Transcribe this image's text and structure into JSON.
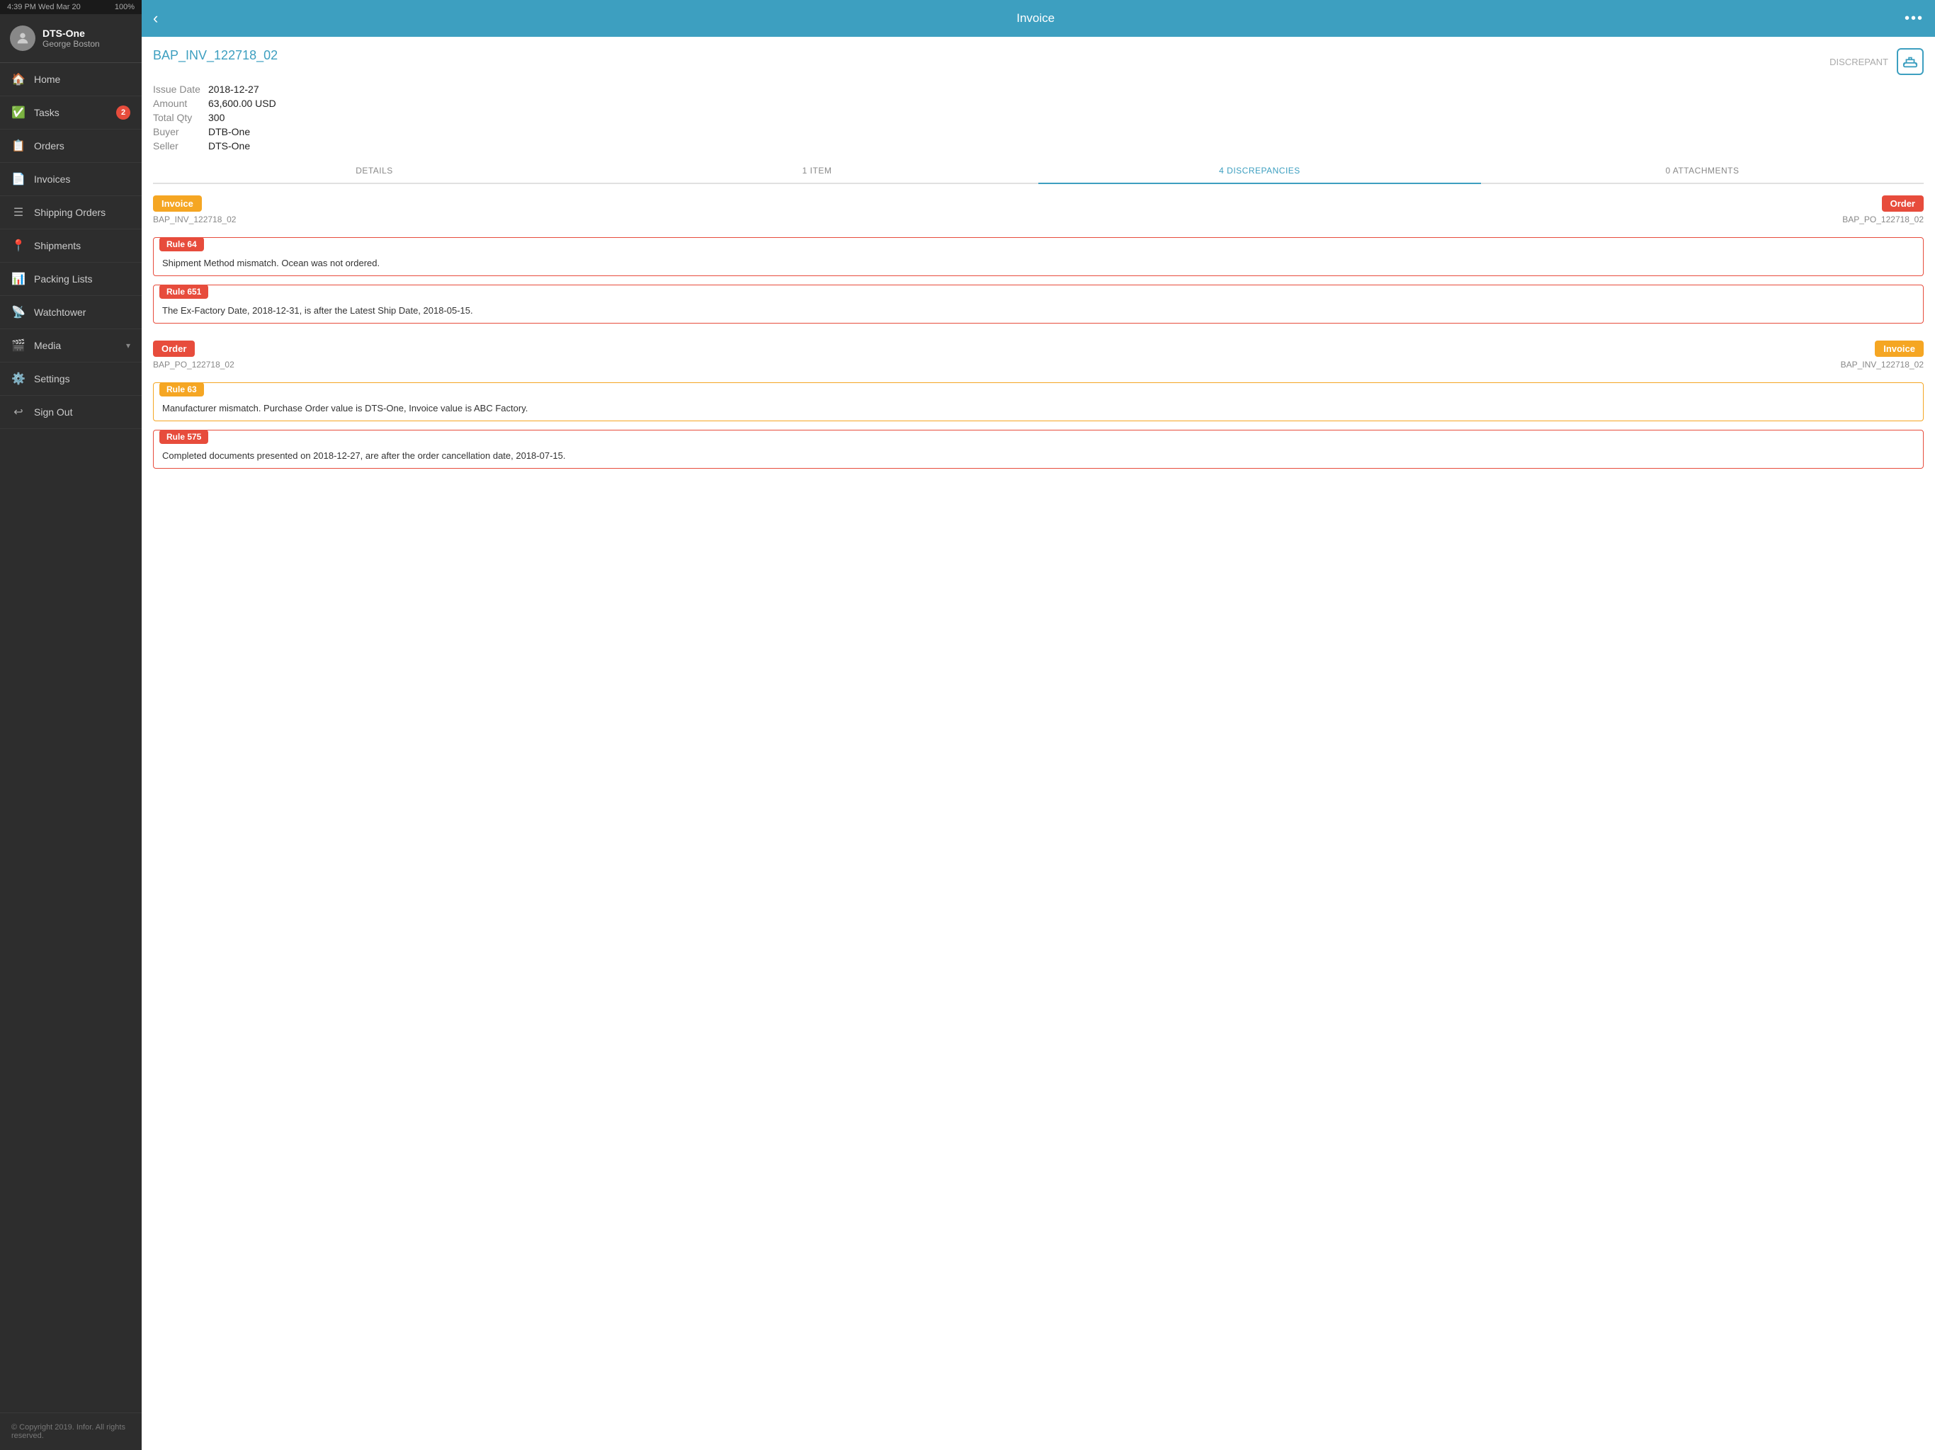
{
  "statusBar": {
    "time": "4:39 PM Wed Mar 20",
    "battery": "100%"
  },
  "sidebar": {
    "userName": "DTS-One",
    "userSub": "George Boston",
    "items": [
      {
        "id": "home",
        "label": "Home",
        "icon": "🏠",
        "badge": null
      },
      {
        "id": "tasks",
        "label": "Tasks",
        "icon": "✅",
        "badge": "2"
      },
      {
        "id": "orders",
        "label": "Orders",
        "icon": "📋",
        "badge": null
      },
      {
        "id": "invoices",
        "label": "Invoices",
        "icon": "📄",
        "badge": null
      },
      {
        "id": "shipping-orders",
        "label": "Shipping Orders",
        "icon": "☰",
        "badge": null
      },
      {
        "id": "shipments",
        "label": "Shipments",
        "icon": "📍",
        "badge": null
      },
      {
        "id": "packing-lists",
        "label": "Packing Lists",
        "icon": "📊",
        "badge": null
      },
      {
        "id": "watchtower",
        "label": "Watchtower",
        "icon": "📡",
        "badge": null
      },
      {
        "id": "media",
        "label": "Media",
        "icon": "🎬",
        "badge": null,
        "arrow": "▾"
      },
      {
        "id": "settings",
        "label": "Settings",
        "icon": "⚙️",
        "badge": null
      },
      {
        "id": "sign-out",
        "label": "Sign Out",
        "icon": "↩",
        "badge": null
      }
    ],
    "copyright": "© Copyright 2019. Infor. All rights reserved."
  },
  "header": {
    "title": "Invoice",
    "backLabel": "‹",
    "moreLabel": "•••"
  },
  "invoice": {
    "id": "BAP_INV_122718_02",
    "discrepant": "DISCREPANT",
    "issueDate": "2018-12-27",
    "amount": "63,600.00 USD",
    "totalQty": "300",
    "buyer": "DTB-One",
    "seller": "DTS-One",
    "issueDateLabel": "Issue Date",
    "amountLabel": "Amount",
    "totalQtyLabel": "Total Qty",
    "buyerLabel": "Buyer",
    "sellerLabel": "Seller"
  },
  "tabs": [
    {
      "id": "details",
      "label": "DETAILS",
      "active": false
    },
    {
      "id": "items",
      "label": "1 ITEM",
      "active": false
    },
    {
      "id": "discrepancies",
      "label": "4 DISCREPANCIES",
      "active": true
    },
    {
      "id": "attachments",
      "label": "0 ATTACHMENTS",
      "active": false
    }
  ],
  "discrepancies": [
    {
      "leftTag": "Invoice",
      "leftTagClass": "tag-invoice",
      "leftId": "BAP_INV_122718_02",
      "rightTag": "Order",
      "rightTagClass": "tag-order",
      "rightId": "BAP_PO_122718_02",
      "rules": [
        {
          "ruleLabel": "Rule 64",
          "ruleClass": "red",
          "text": "Shipment Method mismatch. Ocean was not ordered."
        },
        {
          "ruleLabel": "Rule 651",
          "ruleClass": "red",
          "text": "The Ex-Factory Date, 2018-12-31, is after the Latest Ship Date, 2018-05-15."
        }
      ]
    },
    {
      "leftTag": "Order",
      "leftTagClass": "tag-order",
      "leftId": "BAP_PO_122718_02",
      "rightTag": "Invoice",
      "rightTagClass": "tag-invoice",
      "rightId": "BAP_INV_122718_02",
      "rules": [
        {
          "ruleLabel": "Rule 63",
          "ruleClass": "orange",
          "text": "Manufacturer mismatch. Purchase Order value is DTS-One, Invoice value is ABC Factory."
        },
        {
          "ruleLabel": "Rule 575",
          "ruleClass": "red",
          "text": "Completed documents presented on 2018-12-27, are after the order cancellation date, 2018-07-15."
        }
      ]
    }
  ]
}
